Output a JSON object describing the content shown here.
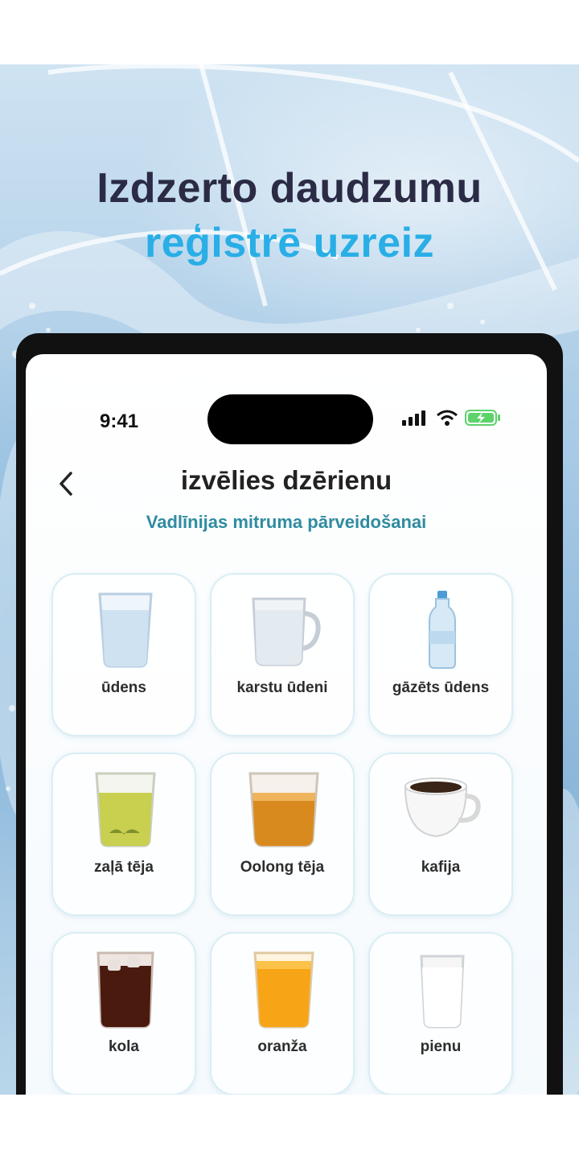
{
  "banner": {
    "headline_line1": "Izdzerto daudzumu",
    "headline_line2": "reģistrē uzreiz",
    "colors": {
      "line1": "#2b2b45",
      "line2": "#29aee6"
    }
  },
  "status_bar": {
    "time": "9:41",
    "icons": [
      "signal-icon",
      "wifi-icon",
      "battery-charging-icon"
    ]
  },
  "header": {
    "back_icon": "chevron-left-icon",
    "title": "izvēlies dzērienu",
    "subtitle": "Vadlīnijas mitruma pārveidošanai"
  },
  "drinks": [
    {
      "label": "ūdens",
      "icon": "water-glass-icon"
    },
    {
      "label": "karstu ūdeni",
      "icon": "mug-icon"
    },
    {
      "label": "gāzēts ūdens",
      "icon": "bottle-icon"
    },
    {
      "label": "zaļā tēja",
      "icon": "green-tea-icon"
    },
    {
      "label": "Oolong tēja",
      "icon": "oolong-tea-icon"
    },
    {
      "label": "kafija",
      "icon": "coffee-cup-icon"
    },
    {
      "label": "kola",
      "icon": "cola-icon"
    },
    {
      "label": "oranža",
      "icon": "orange-juice-icon"
    },
    {
      "label": "pienu",
      "icon": "milk-icon"
    }
  ]
}
